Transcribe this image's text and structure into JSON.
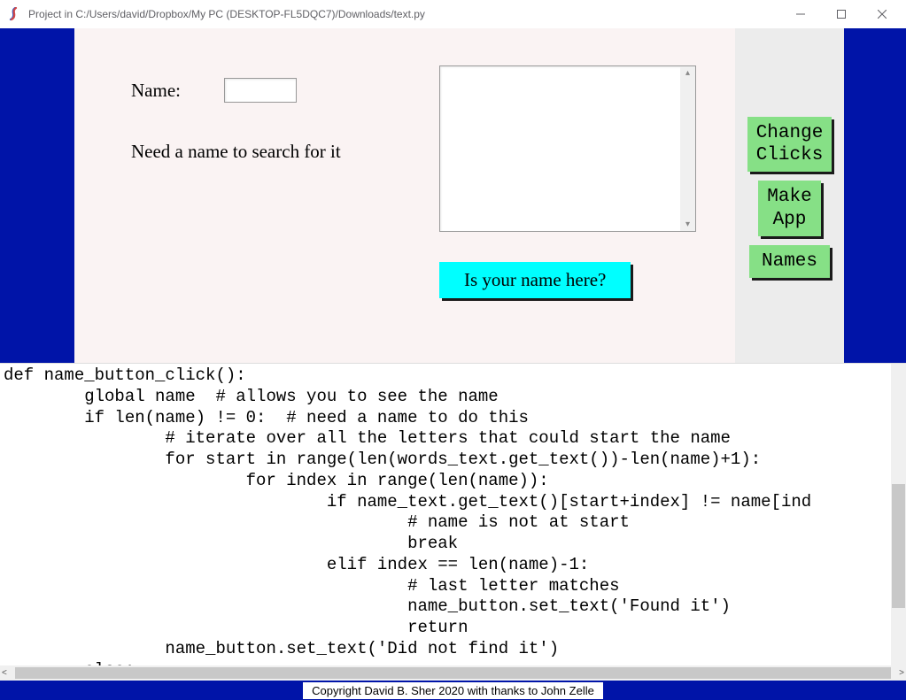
{
  "window": {
    "title": "Project in C:/Users/david/Dropbox/My PC (DESKTOP-FL5DQC7)/Downloads/text.py"
  },
  "form": {
    "name_label": "Name:",
    "name_value": "",
    "response": "Need a name to search for it",
    "textarea_value": ""
  },
  "buttons": {
    "check_name": "Is your name here?",
    "change_clicks": "Change\nClicks",
    "make_app": "Make\nApp",
    "names": "Names"
  },
  "code": "def name_button_click():\n        global name  # allows you to see the name\n        if len(name) != 0:  # need a name to do this\n                # iterate over all the letters that could start the name\n                for start in range(len(words_text.get_text())-len(name)+1):\n                        for index in range(len(name)):\n                                if name_text.get_text()[start+index] != name[ind\n                                        # name is not at start\n                                        break\n                                elif index == len(name)-1:\n                                        # last letter matches\n                                        name_button.set_text('Found it')\n                                        return\n                name_button.set_text('Did not find it')\n        else:\n                response_label.set_text('Need a name to search for it')",
  "footer": {
    "copyright": "Copyright David B. Sher 2020 with thanks to John Zelle"
  }
}
